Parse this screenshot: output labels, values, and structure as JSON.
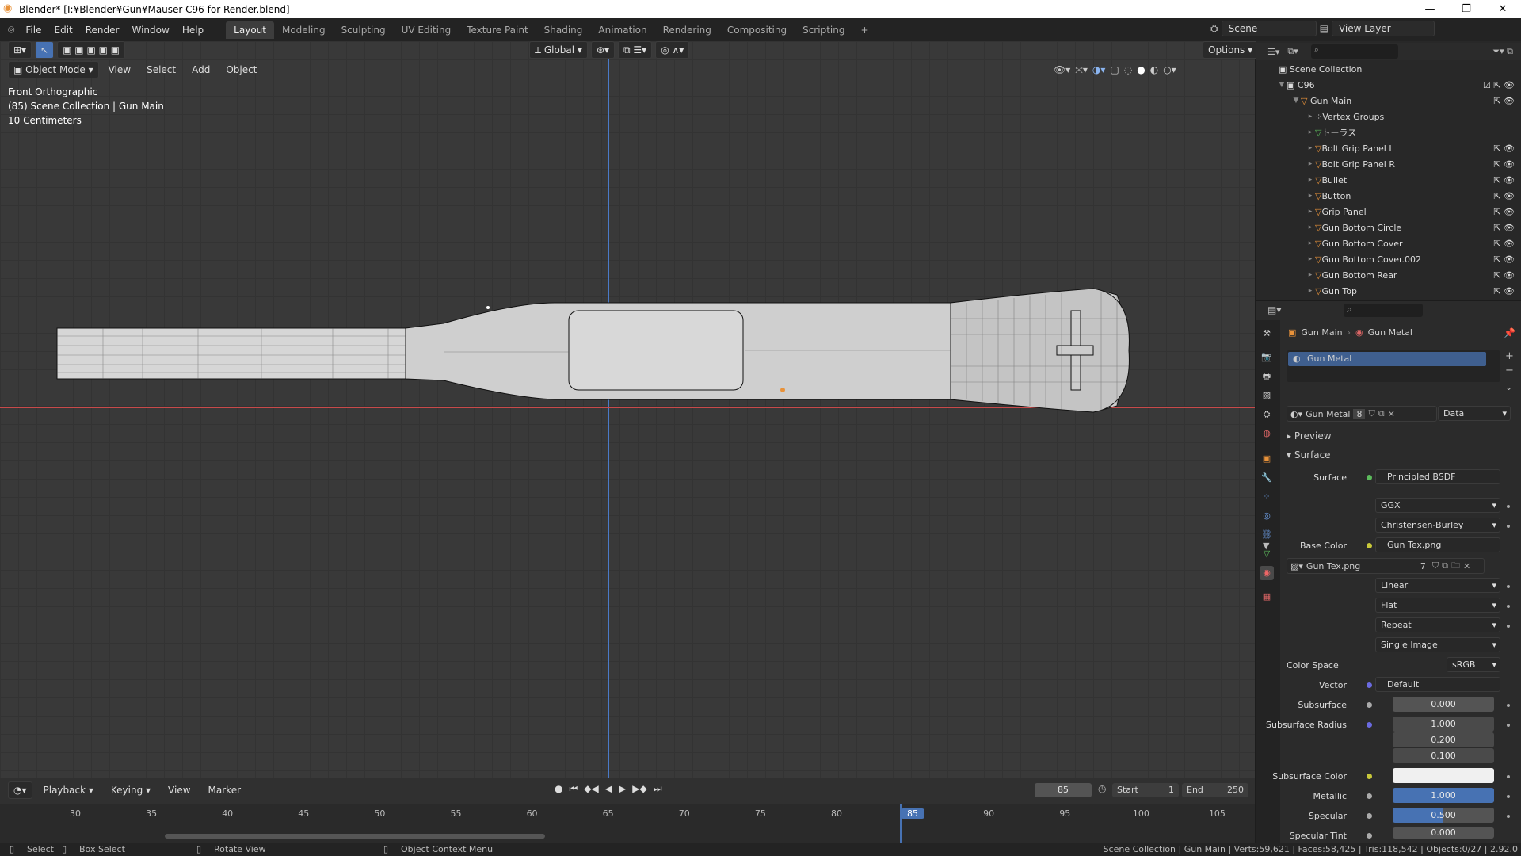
{
  "window": {
    "title": "Blender* [I:¥Blender¥Gun¥Mauser C96 for Render.blend]",
    "min": "—",
    "max": "❐",
    "close": "✕"
  },
  "menu": {
    "items": [
      "File",
      "Edit",
      "Render",
      "Window",
      "Help"
    ]
  },
  "workspaces": [
    "Layout",
    "Modeling",
    "Sculpting",
    "UV Editing",
    "Texture Paint",
    "Shading",
    "Animation",
    "Rendering",
    "Compositing",
    "Scripting"
  ],
  "scene": {
    "name": "Scene",
    "view_layer": "View Layer"
  },
  "viewport": {
    "mode": "Object Mode",
    "menus": [
      "View",
      "Select",
      "Add",
      "Object"
    ],
    "orientation": "Global",
    "options": "Options",
    "overlay_lines": [
      "Front Orthographic",
      "(85) Scene Collection | Gun Main",
      "10 Centimeters"
    ]
  },
  "outliner": {
    "root": "Scene Collection",
    "collection": "C96",
    "parent": "Gun Main",
    "children": [
      "Vertex Groups",
      "トーラス",
      "Bolt Grip Panel L",
      "Bolt Grip Panel R",
      "Bullet",
      "Button",
      "Grip Panel",
      "Gun Bottom Circle",
      "Gun Bottom Cover",
      "Gun Bottom Cover.002",
      "Gun Bottom Rear",
      "Gun Top"
    ]
  },
  "properties": {
    "breadcrumb_object": "Gun Main",
    "breadcrumb_material": "Gun Metal",
    "slot": "Gun Metal",
    "material_name": "Gun Metal",
    "users": "8",
    "link": "Data",
    "preview": "Preview",
    "surface_panel": "Surface",
    "surface_label": "Surface",
    "surface_value": "Principled BSDF",
    "distribution": "GGX",
    "sss_method": "Christensen-Burley",
    "base_color_label": "Base Color",
    "base_color_value": "Gun Tex.png",
    "image_name": "Gun Tex.png",
    "image_users": "7",
    "interpolation": "Linear",
    "projection": "Flat",
    "extension": "Repeat",
    "source": "Single Image",
    "color_space_label": "Color Space",
    "color_space_value": "sRGB",
    "vector_label": "Vector",
    "vector_value": "Default",
    "subsurface_label": "Subsurface",
    "subsurface_value": "0.000",
    "sss_radius_label": "Subsurface Radius",
    "sss_radius": [
      "1.000",
      "0.200",
      "0.100"
    ],
    "sss_color_label": "Subsurface Color",
    "metallic_label": "Metallic",
    "metallic_value": "1.000",
    "metallic_fill": 1.0,
    "specular_label": "Specular",
    "specular_value": "0.500",
    "specular_fill": 0.5,
    "spec_tint_label": "Specular Tint",
    "spec_tint_value": "0.000"
  },
  "timeline": {
    "menus": [
      "Playback",
      "Keying",
      "View",
      "Marker"
    ],
    "current_frame": "85",
    "start_label": "Start",
    "start": "1",
    "end_label": "End",
    "end": "250",
    "ticks": [
      "30",
      "35",
      "40",
      "45",
      "50",
      "55",
      "60",
      "65",
      "70",
      "75",
      "80",
      "85",
      "90",
      "95",
      "100",
      "105"
    ]
  },
  "status": {
    "select": "Select",
    "box_select": "Box Select",
    "rotate": "Rotate View",
    "context": "Object Context Menu",
    "stats": "Scene Collection | Gun Main | Verts:59,621 | Faces:58,425 | Tris:118,542 | Objects:0/27 | 2.92.0"
  },
  "colors": {
    "accent": "#4772b3",
    "selected_frame": "#4772b3",
    "x_axis": "#c84a4a",
    "y_axis": "#4a7ac8",
    "mesh_orange": "#e8923a"
  }
}
